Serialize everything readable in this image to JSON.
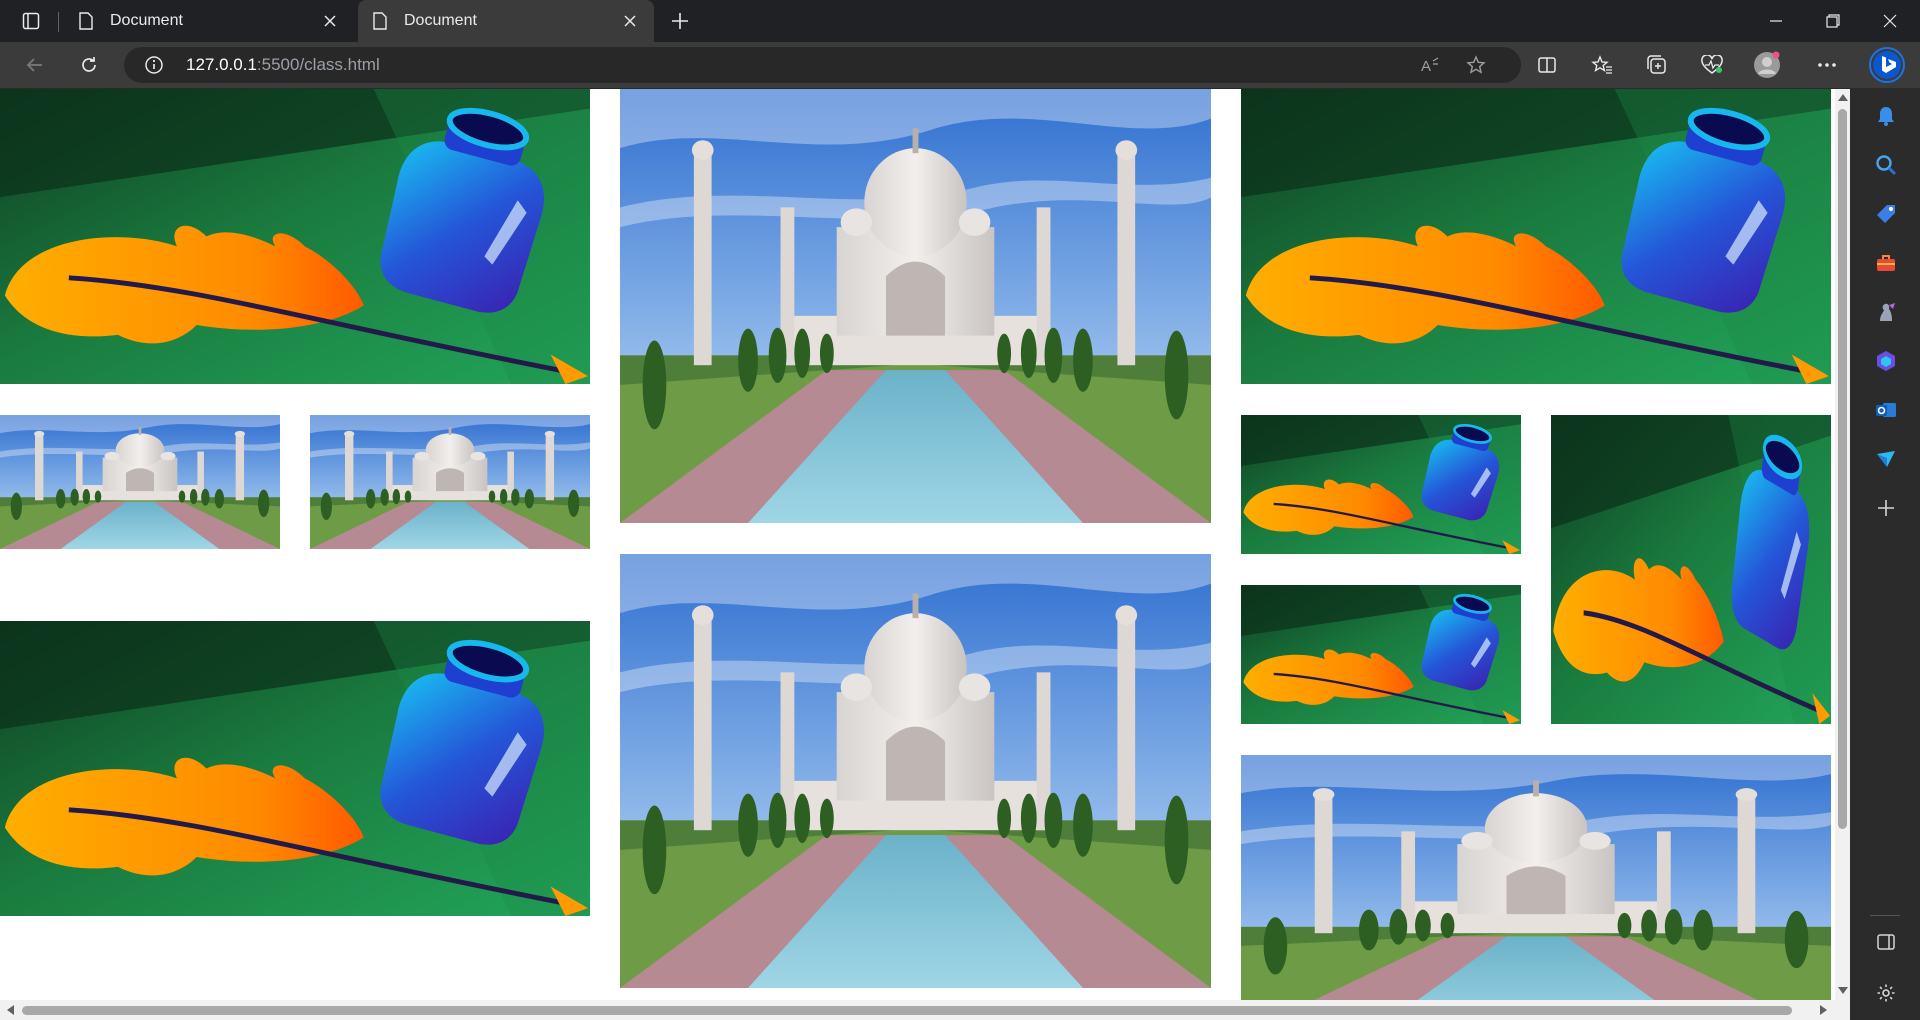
{
  "browser": {
    "tabs": [
      {
        "title": "Document",
        "active": false
      },
      {
        "title": "Document",
        "active": true
      }
    ],
    "address": {
      "host": "127.0.0.1",
      "path": ":5500/class.html"
    },
    "accent_color": "#1a73e8"
  },
  "icons": {
    "tab_actions": "tab-actions-icon",
    "new_tab": "plus-icon",
    "back": "back-arrow-icon",
    "refresh": "refresh-icon",
    "site_info": "info-icon",
    "read_aloud": "read-aloud-icon",
    "favorite": "star-icon",
    "split_screen": "split-screen-icon",
    "favorites": "favorites-icon",
    "collections": "collections-icon",
    "performance": "heart-pulse-icon",
    "profile": "profile-icon",
    "more": "more-icon",
    "copilot": "copilot-icon"
  },
  "sidebar": {
    "items": [
      "bell-icon",
      "search-icon",
      "shopping-tag-icon",
      "toolbox-icon",
      "games-icon",
      "copilot-m365-icon",
      "outlook-icon",
      "drop-icon",
      "add-icon"
    ],
    "bottom": [
      "panel-icon",
      "settings-icon"
    ]
  },
  "gallery": {
    "images": [
      {
        "name": "quill-ink",
        "alt": "Quill and ink bottle illustration"
      },
      {
        "name": "taj-mahal",
        "alt": "Taj Mahal"
      }
    ]
  }
}
